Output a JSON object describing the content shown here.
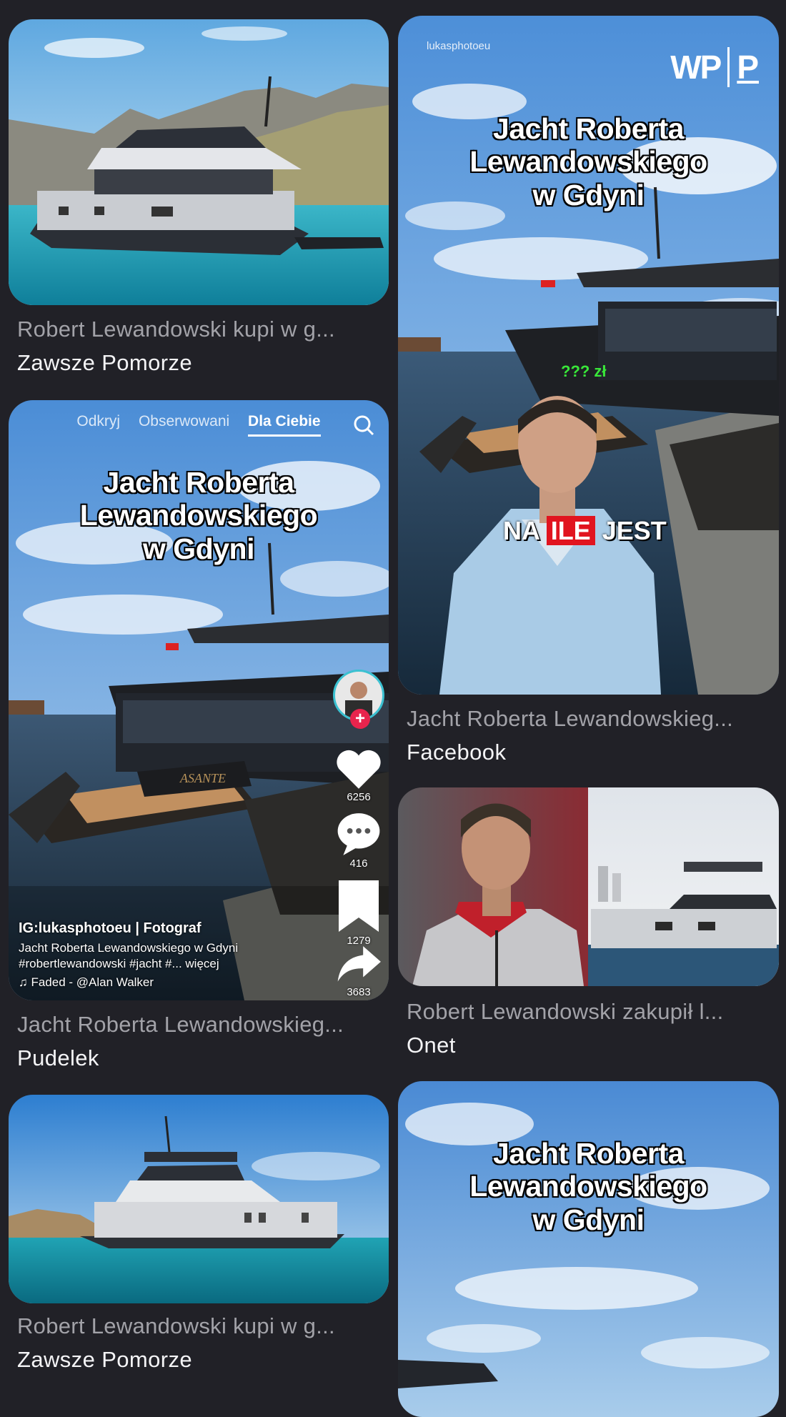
{
  "cards": [
    {
      "id": "c1",
      "caption": "Robert Lewandowski kupi w g...",
      "source": "Zawsze Pomorze"
    },
    {
      "id": "c2",
      "caption": "Jacht Roberta Lewandowskieg...",
      "source": "Facebook",
      "overlay_title": [
        "Jacht Roberta",
        "Lewandowskiego",
        "w Gdyni"
      ],
      "watermark": "lukasphotoeu",
      "logo": "WP",
      "logo2": "P",
      "price_text": "??? zł",
      "banner": [
        "NA",
        "ILE",
        "JEST"
      ]
    },
    {
      "id": "c3",
      "caption": "Jacht Roberta Lewandowskieg...",
      "source": "Pudelek",
      "tabs": [
        "Odkryj",
        "Obserwowani",
        "Dla Ciebie"
      ],
      "overlay_title": [
        "Jacht Roberta",
        "Lewandowskiego",
        "w Gdyni"
      ],
      "boat_name": "ASANTE",
      "likes": "6256",
      "comments": "416",
      "saves": "1279",
      "shares": "3683",
      "account": "IG:lukasphotoeu | Fotograf",
      "desc1": "Jacht Roberta Lewandowskiego w Gdyni",
      "desc2": "#robertlewandowski #jacht #... więcej",
      "music": "♫ Faded - @Alan Walker"
    },
    {
      "id": "c4",
      "caption": "Robert Lewandowski zakupił l...",
      "source": "Onet"
    },
    {
      "id": "c5",
      "caption": "Robert Lewandowski kupi w g...",
      "source": "Zawsze Pomorze"
    },
    {
      "id": "c6",
      "overlay_title": [
        "Jacht Roberta",
        "Lewandowskiego",
        "w Gdyni"
      ]
    }
  ],
  "icons": {
    "search": "search-icon",
    "heart": "heart-icon",
    "comment": "comment-icon",
    "bookmark": "bookmark-icon",
    "share": "share-icon",
    "plus": "plus-icon"
  },
  "colors": {
    "background": "#212127",
    "caption": "#a2a2a8",
    "source": "#f4f4f6",
    "price": "#39e639",
    "banner_red": "#e1141f"
  }
}
